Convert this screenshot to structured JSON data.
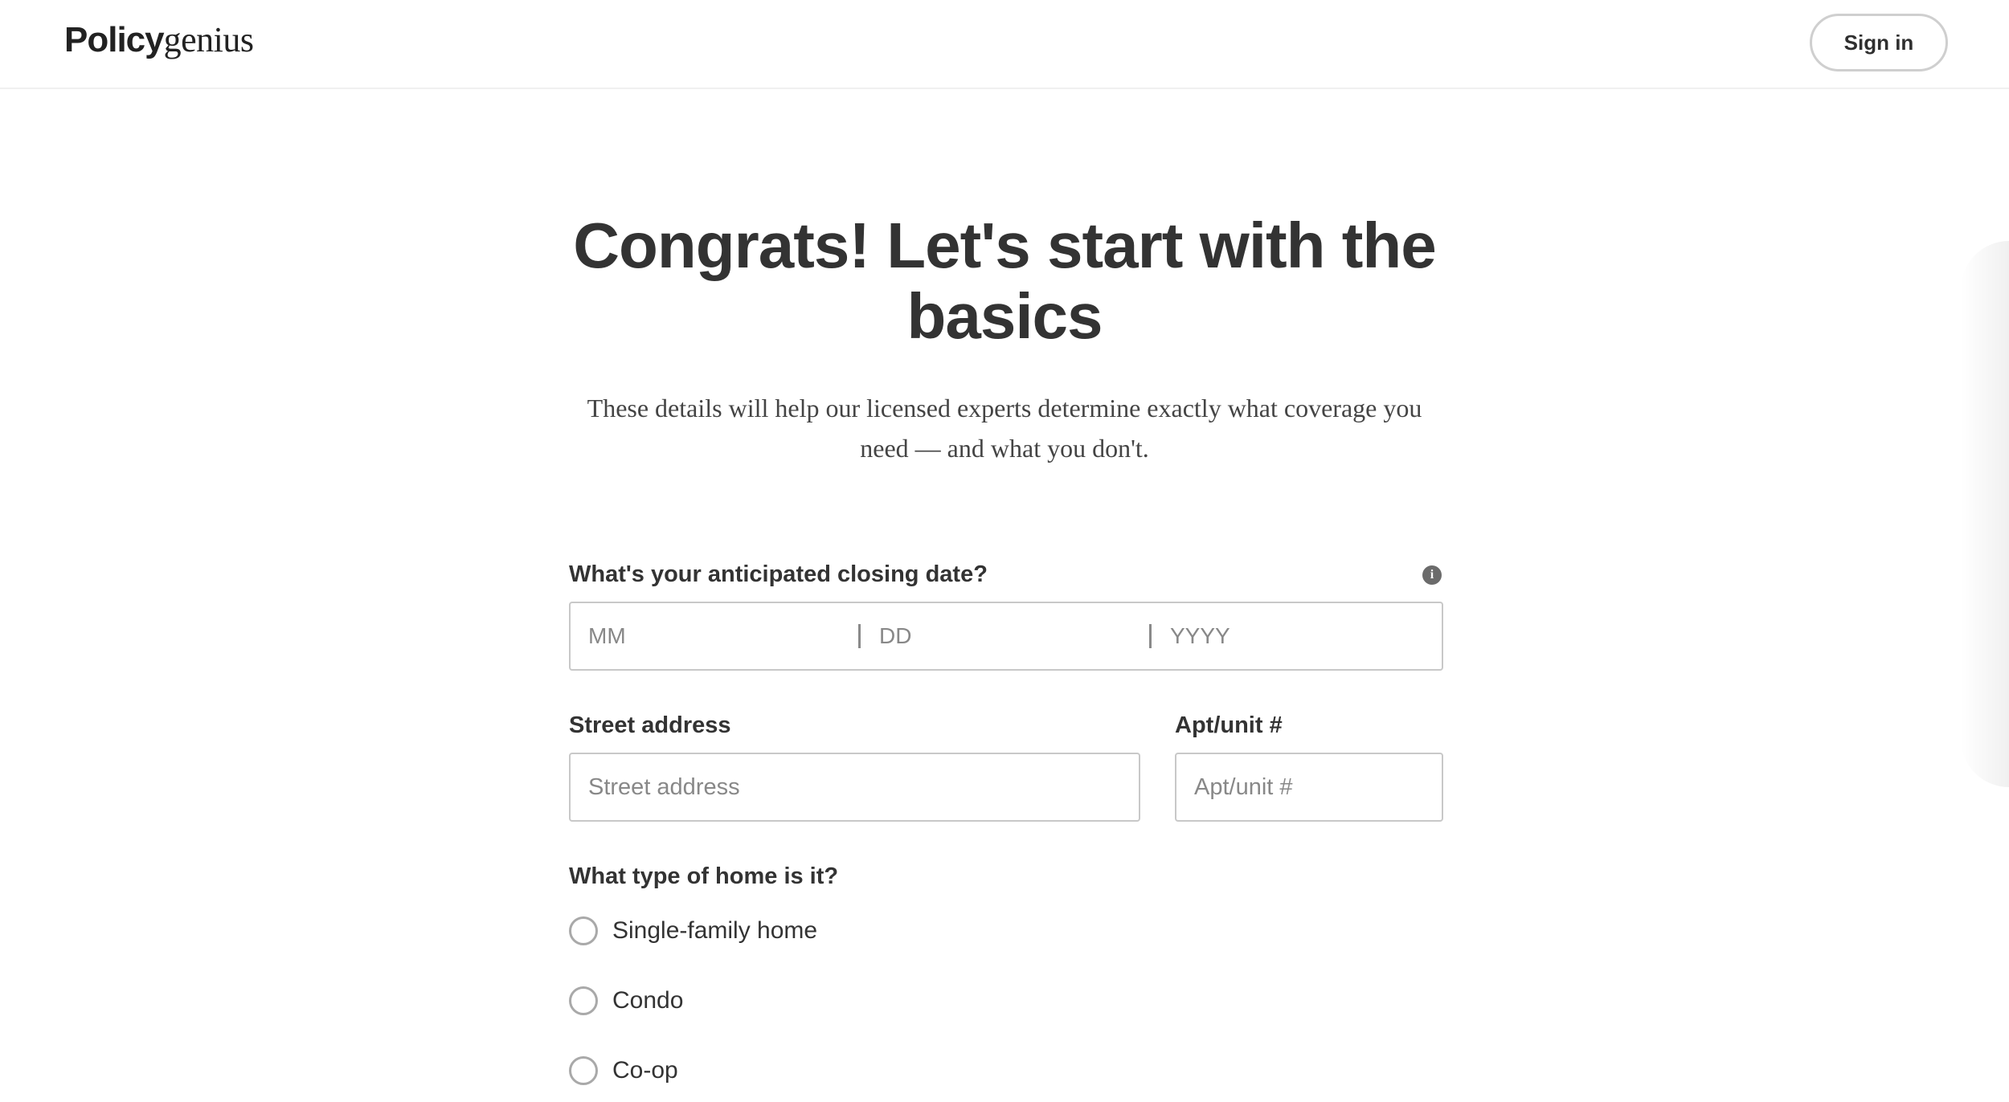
{
  "header": {
    "logo_bold": "Policy",
    "logo_light": "genius",
    "sign_in_label": "Sign in"
  },
  "main": {
    "title_line1": "Congrats! Let's start with the",
    "title_line2": "basics",
    "subtitle_line1": "These details will help our licensed experts determine exactly what coverage you",
    "subtitle_line2": "need — and what you don't."
  },
  "form": {
    "closing_date": {
      "label": "What's your anticipated closing date?",
      "info_icon": "info-icon",
      "month_placeholder": "MM",
      "day_placeholder": "DD",
      "year_placeholder": "YYYY",
      "separator": "|"
    },
    "street": {
      "label": "Street address",
      "placeholder": "Street address",
      "value": ""
    },
    "apt": {
      "label": "Apt/unit #",
      "placeholder": "Apt/unit #",
      "value": ""
    },
    "home_type": {
      "label": "What type of home is it?",
      "options": [
        {
          "label": "Single-family home",
          "selected": false
        },
        {
          "label": "Condo",
          "selected": false
        },
        {
          "label": "Co-op",
          "selected": false
        }
      ]
    }
  },
  "colors": {
    "text": "#333333",
    "border": "#c8c8c8",
    "placeholder": "#888888",
    "background": "#ffffff"
  }
}
